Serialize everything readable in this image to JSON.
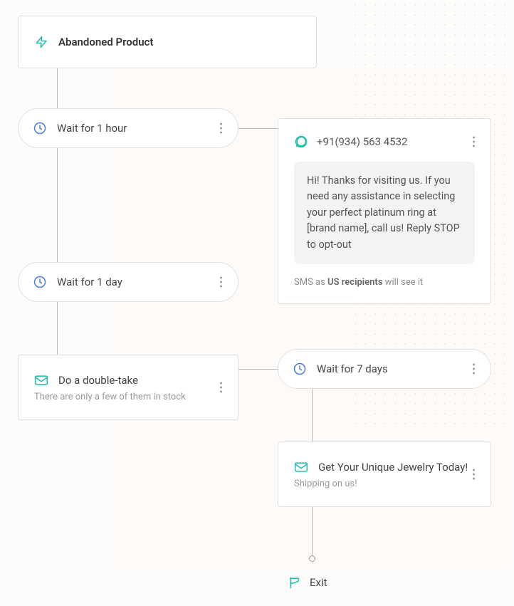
{
  "start": {
    "title": "Abandoned Product"
  },
  "wait": {
    "hour": "Wait for 1 hour",
    "day": "Wait for 1 day",
    "week": "Wait for 7 days"
  },
  "email": {
    "doubleTake": {
      "title": "Do a double-take",
      "subtitle": "There are only a few of them in stock"
    },
    "jewelry": {
      "title": "Get Your Unique Jewelry Today!",
      "subtitle": "Shipping on us!"
    }
  },
  "sms": {
    "phone": "+91(934) 563 4532",
    "message": "Hi! Thanks for visiting us. If you need any assistance in selecting your perfect platinum ring at [brand name], call us! Reply STOP to opt-out",
    "note_prefix": "SMS as ",
    "note_bold": "US recipients",
    "note_suffix": " will see it"
  },
  "exit": {
    "label": "Exit"
  }
}
